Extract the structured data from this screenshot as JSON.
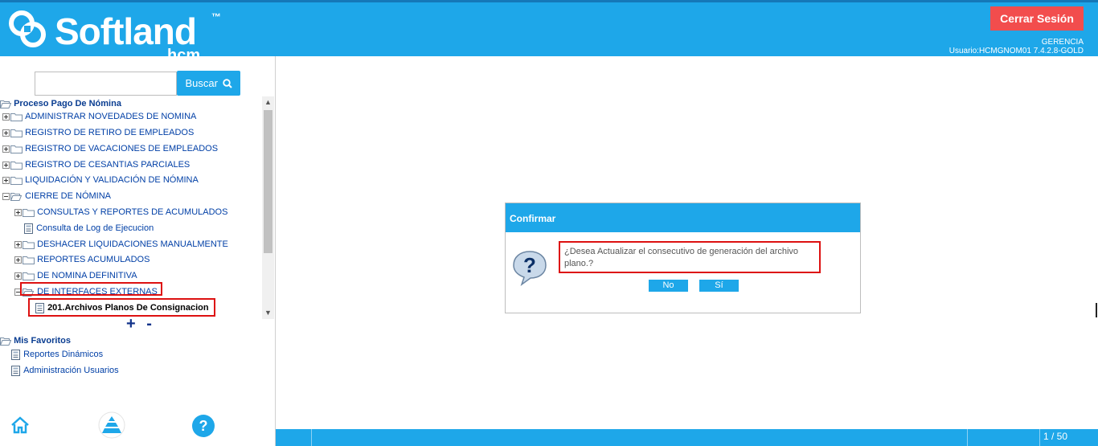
{
  "header": {
    "brand": "Softland",
    "brand_tm": "™",
    "brand_sub": "hcm",
    "logout_label": "Cerrar Sesión",
    "company": "GERENCIA",
    "user_version": "Usuario:HCMGNOM01 7.4.2.8-GOLD"
  },
  "sidebar": {
    "search_value": "",
    "search_label": "Buscar",
    "tree": {
      "root": "Proceso Pago De Nómina",
      "items": [
        "ADMINISTRAR NOVEDADES DE NOMINA",
        "REGISTRO DE RETIRO DE EMPLEADOS",
        "REGISTRO DE VACACIONES DE EMPLEADOS",
        "REGISTRO DE CESANTIAS PARCIALES",
        "LIQUIDACIÓN Y VALIDACIÓN DE NÓMINA",
        "CIERRE DE NÓMINA"
      ],
      "cierre_children": [
        "CONSULTAS Y REPORTES DE ACUMULADOS",
        "Consulta de Log de Ejecucion",
        "DESHACER LIQUIDACIONES MANUALMENTE",
        "REPORTES ACUMULADOS",
        "DE NOMINA DEFINITIVA",
        "DE INTERFACES EXTERNAS"
      ],
      "selected": "201.Archivos Planos De Consignacion"
    },
    "zoom_controls": "+ -",
    "favorites": {
      "title": "Mis Favoritos",
      "items": [
        "Reportes Dinámicos",
        "Administración Usuarios"
      ]
    },
    "bottom_icons": [
      "home-icon",
      "pyramid-icon",
      "help-icon"
    ]
  },
  "dialog": {
    "title": "Confirmar",
    "message": "¿Desea Actualizar el consecutivo de generación del archivo plano.?",
    "no_label": "No",
    "yes_label": "Sí"
  },
  "statusbar": {
    "pager": "1 / 50"
  },
  "colors": {
    "brand_blue": "#1ea7e9",
    "logout_red": "#f24d4d",
    "highlight_red": "#dd1111",
    "tree_text": "#003fa6"
  }
}
